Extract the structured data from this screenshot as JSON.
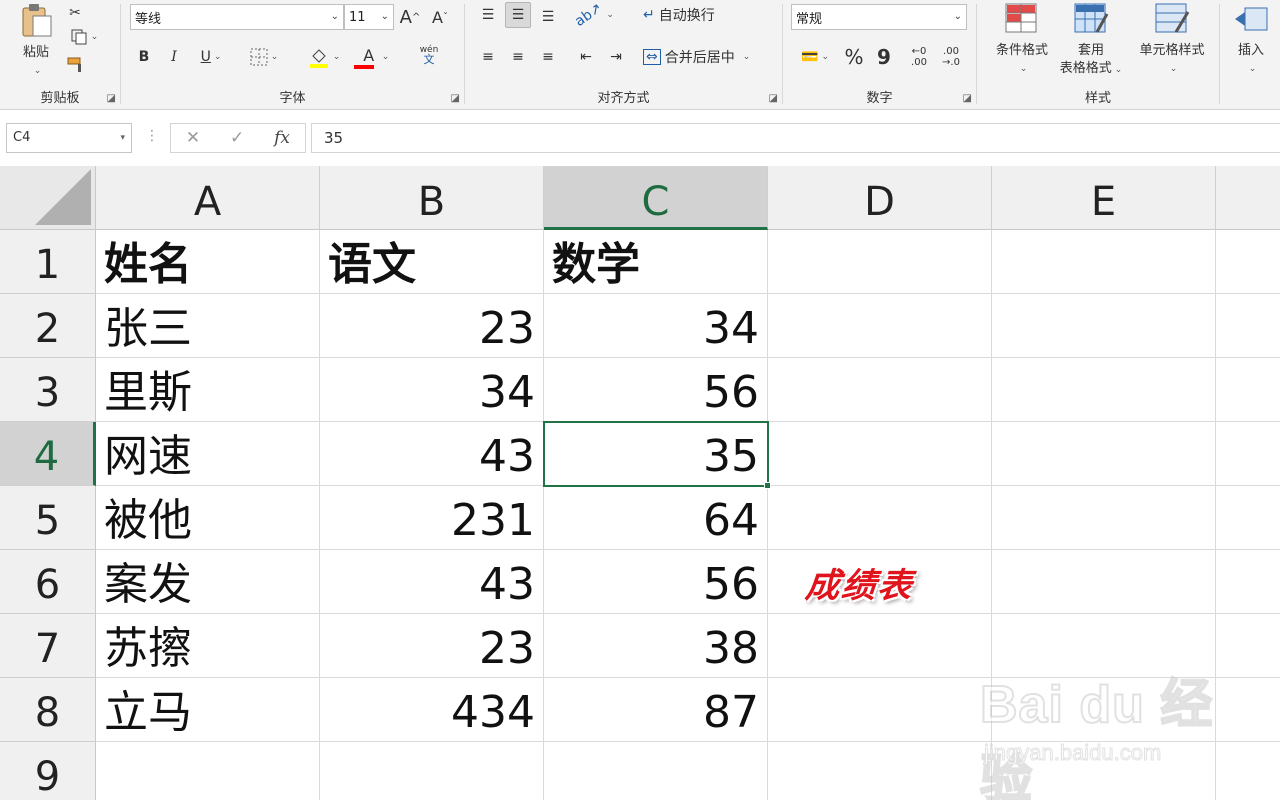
{
  "ribbon": {
    "clipboard": {
      "paste": "粘贴",
      "group": "剪贴板"
    },
    "font": {
      "name": "等线",
      "size": "11",
      "grow": "A",
      "shrink": "A",
      "bold": "B",
      "italic": "I",
      "underline": "U",
      "font_color_glyph": "A",
      "phonetic_top": "wén",
      "phonetic_bottom": "文",
      "group": "字体"
    },
    "alignment": {
      "wrap_text": "自动换行",
      "merge_center": "合并后居中",
      "group": "对齐方式"
    },
    "number": {
      "format": "常规",
      "percent": "%",
      "comma": "9",
      "inc_decimal_top": "←0",
      "inc_decimal_bottom": ".00",
      "dec_decimal_top": ".00",
      "dec_decimal_bottom": "→.0",
      "group": "数字"
    },
    "styles": {
      "conditional": "条件格式",
      "table_line1": "套用",
      "table_line2": "表格格式",
      "cell_styles": "单元格样式",
      "group": "样式"
    },
    "cells": {
      "insert": "插入"
    },
    "colors": {
      "highlight": "#ffff00",
      "font_color": "#ff0000"
    }
  },
  "formula_bar": {
    "name_box": "C4",
    "dots": "⋮",
    "cancel": "✕",
    "enter": "✓",
    "fx": "fx",
    "value": "35"
  },
  "sheet": {
    "columns": [
      "A",
      "B",
      "C",
      "D",
      "E"
    ],
    "selected_column": "C",
    "rows": [
      {
        "num": "1",
        "a": "姓名",
        "b": "语文",
        "c": "数学"
      },
      {
        "num": "2",
        "a": "张三",
        "b": "23",
        "c": "34"
      },
      {
        "num": "3",
        "a": "里斯",
        "b": "34",
        "c": "56"
      },
      {
        "num": "4",
        "a": "网速",
        "b": "43",
        "c": "35"
      },
      {
        "num": "5",
        "a": "被他",
        "b": "231",
        "c": "64"
      },
      {
        "num": "6",
        "a": "案发",
        "b": "43",
        "c": "56"
      },
      {
        "num": "7",
        "a": "苏擦",
        "b": "23",
        "c": "38"
      },
      {
        "num": "8",
        "a": "立马",
        "b": "434",
        "c": "87"
      },
      {
        "num": "9",
        "a": "",
        "b": "",
        "c": ""
      }
    ],
    "selected_row": "4",
    "selected_cell": "C4",
    "annotation": "成绩表",
    "accent": "#217346"
  },
  "watermark": {
    "main": "Bai du 经验",
    "sub": "jingyan.baidu.com"
  }
}
